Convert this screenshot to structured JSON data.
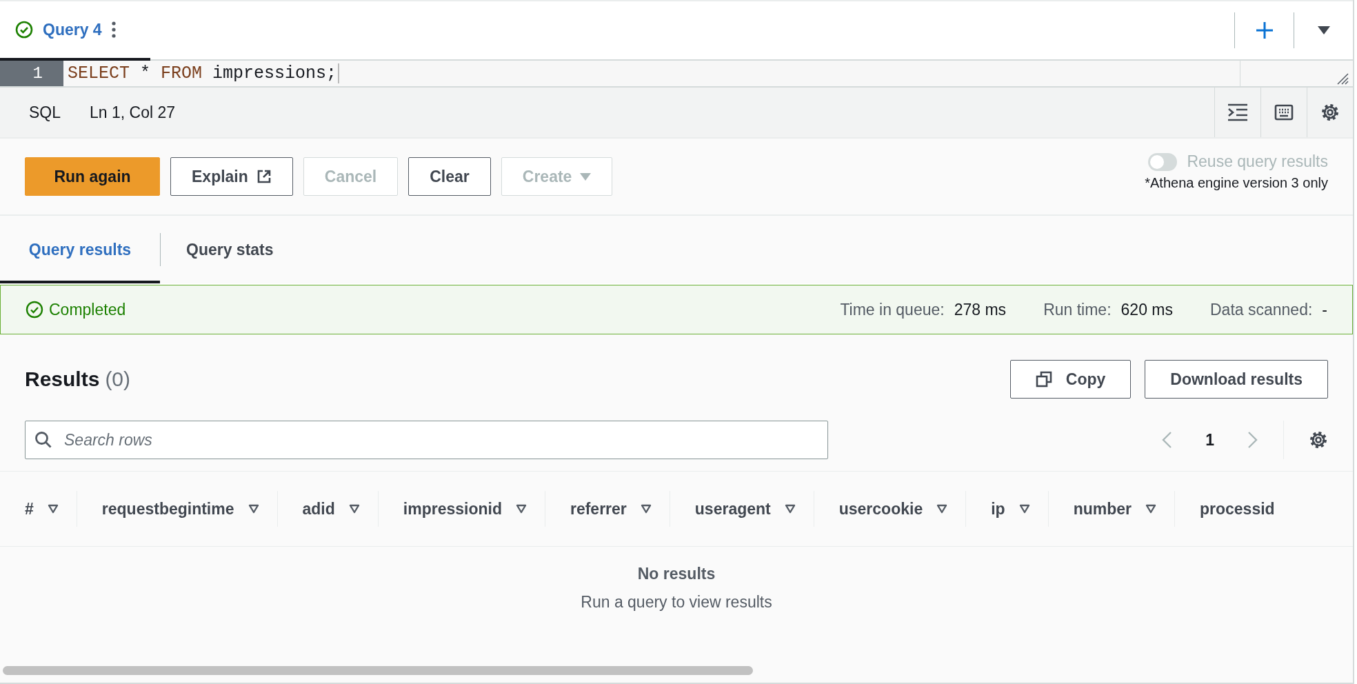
{
  "query_tabs": [
    {
      "label": "Query 4",
      "completed": true,
      "selected": true
    }
  ],
  "editor": {
    "lines": [
      {
        "number": "1",
        "tokens": [
          {
            "text": "SELECT",
            "kind": "keyword"
          },
          {
            "text": " * ",
            "kind": "plain"
          },
          {
            "text": "FROM",
            "kind": "keyword"
          },
          {
            "text": " impressions;",
            "kind": "plain"
          }
        ]
      }
    ]
  },
  "status_bar": {
    "language": "SQL",
    "position": "Ln 1, Col 27"
  },
  "actions": [
    {
      "label": "Run again",
      "kind": "primary",
      "disabled": false
    },
    {
      "label": "Explain",
      "kind": "external",
      "disabled": false
    },
    {
      "label": "Cancel",
      "kind": "normal",
      "disabled": true
    },
    {
      "label": "Clear",
      "kind": "normal",
      "disabled": false
    },
    {
      "label": "Create",
      "kind": "dropdown",
      "disabled": true
    }
  ],
  "reuse_toggle": {
    "label": "Reuse query results",
    "on": false,
    "disabled": true,
    "note": "*Athena engine version 3 only"
  },
  "result_tabs": [
    {
      "label": "Query results",
      "selected": true
    },
    {
      "label": "Query stats",
      "selected": false
    }
  ],
  "status": {
    "label": "Completed",
    "stats": [
      {
        "label": "Time in queue:",
        "value": "278 ms"
      },
      {
        "label": "Run time:",
        "value": "620 ms"
      },
      {
        "label": "Data scanned:",
        "value": "-"
      }
    ]
  },
  "results": {
    "title": "Results",
    "count": "(0)",
    "buttons": [
      {
        "label": "Copy",
        "kind": "copy"
      },
      {
        "label": "Download results",
        "kind": "plain"
      }
    ],
    "search": {
      "placeholder": "Search rows"
    },
    "page": "1",
    "columns": [
      {
        "label": "#",
        "sortable": true
      },
      {
        "label": "requestbegintime",
        "sortable": true
      },
      {
        "label": "adid",
        "sortable": true
      },
      {
        "label": "impressionid",
        "sortable": true
      },
      {
        "label": "referrer",
        "sortable": true
      },
      {
        "label": "useragent",
        "sortable": true
      },
      {
        "label": "usercookie",
        "sortable": true
      },
      {
        "label": "ip",
        "sortable": true
      },
      {
        "label": "number",
        "sortable": true
      },
      {
        "label": "processid",
        "sortable": false
      }
    ],
    "empty": {
      "title": "No results",
      "message": "Run a query to view results"
    }
  }
}
